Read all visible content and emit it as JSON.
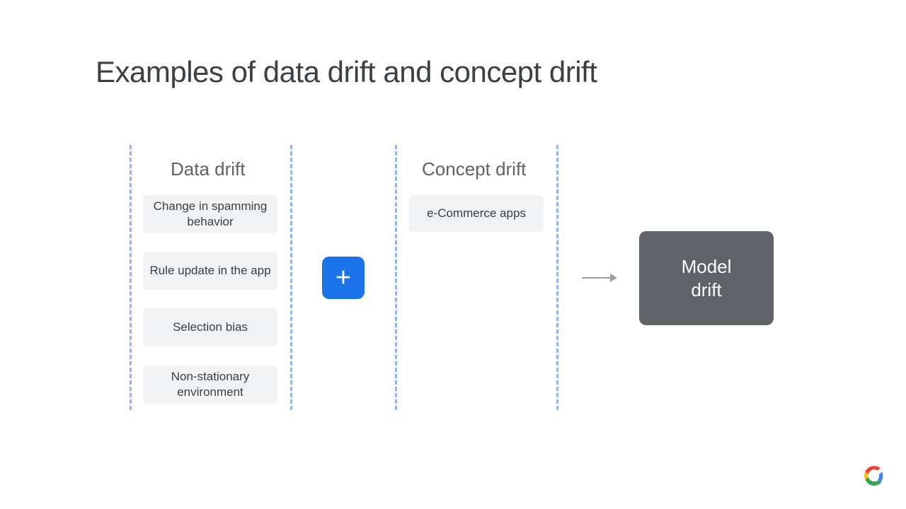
{
  "title": "Examples of data drift and concept drift",
  "columns": {
    "data_drift": {
      "heading": "Data drift",
      "items": [
        "Change in spamming behavior",
        "Rule update in the app",
        "Selection bias",
        "Non-stationary environment"
      ]
    },
    "concept_drift": {
      "heading": "Concept drift",
      "items": [
        "e-Commerce apps"
      ]
    }
  },
  "operator": "+",
  "result": "Model\ndrift"
}
